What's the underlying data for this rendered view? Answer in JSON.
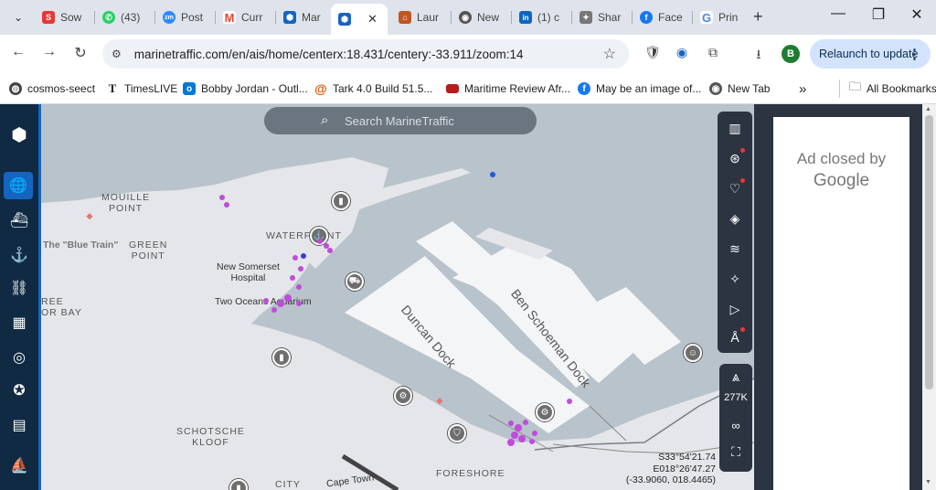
{
  "tabs": [
    {
      "label": "Sow",
      "icon": "s-logo-icon",
      "color": "#e53935"
    },
    {
      "label": "(43)",
      "icon": "whatsapp-icon",
      "color": "#25d366"
    },
    {
      "label": "Post",
      "icon": "zoom-icon",
      "color": "#2d8cff"
    },
    {
      "label": "Curr",
      "icon": "gmail-icon",
      "color": "#ea4335"
    },
    {
      "label": "Mar",
      "icon": "marinetraffic-icon",
      "color": "#1565c0"
    },
    {
      "label": "",
      "icon": "marinetraffic-icon",
      "color": "#1565c0",
      "active": true
    },
    {
      "label": "Laur",
      "icon": "bookmark-icon",
      "color": "#c05621"
    },
    {
      "label": "New",
      "icon": "chrome-icon",
      "color": "#555555"
    },
    {
      "label": "(1) c",
      "icon": "linkedin-icon",
      "color": "#0a66c2"
    },
    {
      "label": "Shar",
      "icon": "africa-icon",
      "color": "#777777"
    },
    {
      "label": "Face",
      "icon": "facebook-icon",
      "color": "#1877f2"
    },
    {
      "label": "Prin",
      "icon": "google-icon",
      "color": "#4285f4"
    }
  ],
  "address": {
    "url": "marinetraffic.com/en/ais/home/centerx:18.431/centery:-33.911/zoom:14",
    "profile_initial": "B",
    "relaunch_label": "Relaunch to update"
  },
  "bookmarks": [
    {
      "label": "cosmos-seect",
      "icon": "globe-icon",
      "color": "#444444"
    },
    {
      "label": "TimesLIVE",
      "icon": "timeslive-icon",
      "color": "#222222"
    },
    {
      "label": "Bobby Jordan - Outl...",
      "icon": "outlook-icon",
      "color": "#0078d4"
    },
    {
      "label": "Tark  4.0   Build 51.5...",
      "icon": "at-icon",
      "color": "#e65100"
    },
    {
      "label": "Maritime Review Afr...",
      "icon": "flag-icon",
      "color": "#b71c1c"
    },
    {
      "label": "May be an image of...",
      "icon": "facebook-icon",
      "color": "#1877f2"
    },
    {
      "label": "New Tab",
      "icon": "chrome-icon",
      "color": "#555555"
    }
  ],
  "bookmarks_more": "»",
  "all_bookmarks": "All Bookmarks",
  "search": {
    "placeholder": "Search MarineTraffic"
  },
  "map_labels": {
    "mouille_point": "MOUILLE\nPOINT",
    "blue_train": "The \"Blue Train\"",
    "green_point": "GREEN\nPOINT",
    "waterfront": "WATERFRONT",
    "new_somerset": "New Somerset\nHospital",
    "two_oceans": "Two Oceans Aquarium",
    "ree_bay": "REE\nOR BAY",
    "duncan_dock": "Duncan Dock",
    "ben_schoeman": "Ben Schoeman Dock",
    "schotsche_kloof": "SCHOTSCHE\nKLOOF",
    "city": "CITY",
    "foreshore": "FORESHORE",
    "cape_town": "Cape Town"
  },
  "tools": {
    "vessel_count": "277K",
    "infinity": "∞"
  },
  "coords": {
    "lat": "S33°54'21.74",
    "lon": "E018°26'47.27",
    "decimal": "(-33.9060, 018.4465)"
  },
  "ad": {
    "text": "Ad closed by",
    "brand": "Google"
  },
  "colors": {
    "vessel": "#c04bdc",
    "vessel_blue": "#3b3bd6",
    "nav_bg": "#102a43",
    "nav_active": "#1565c0"
  }
}
